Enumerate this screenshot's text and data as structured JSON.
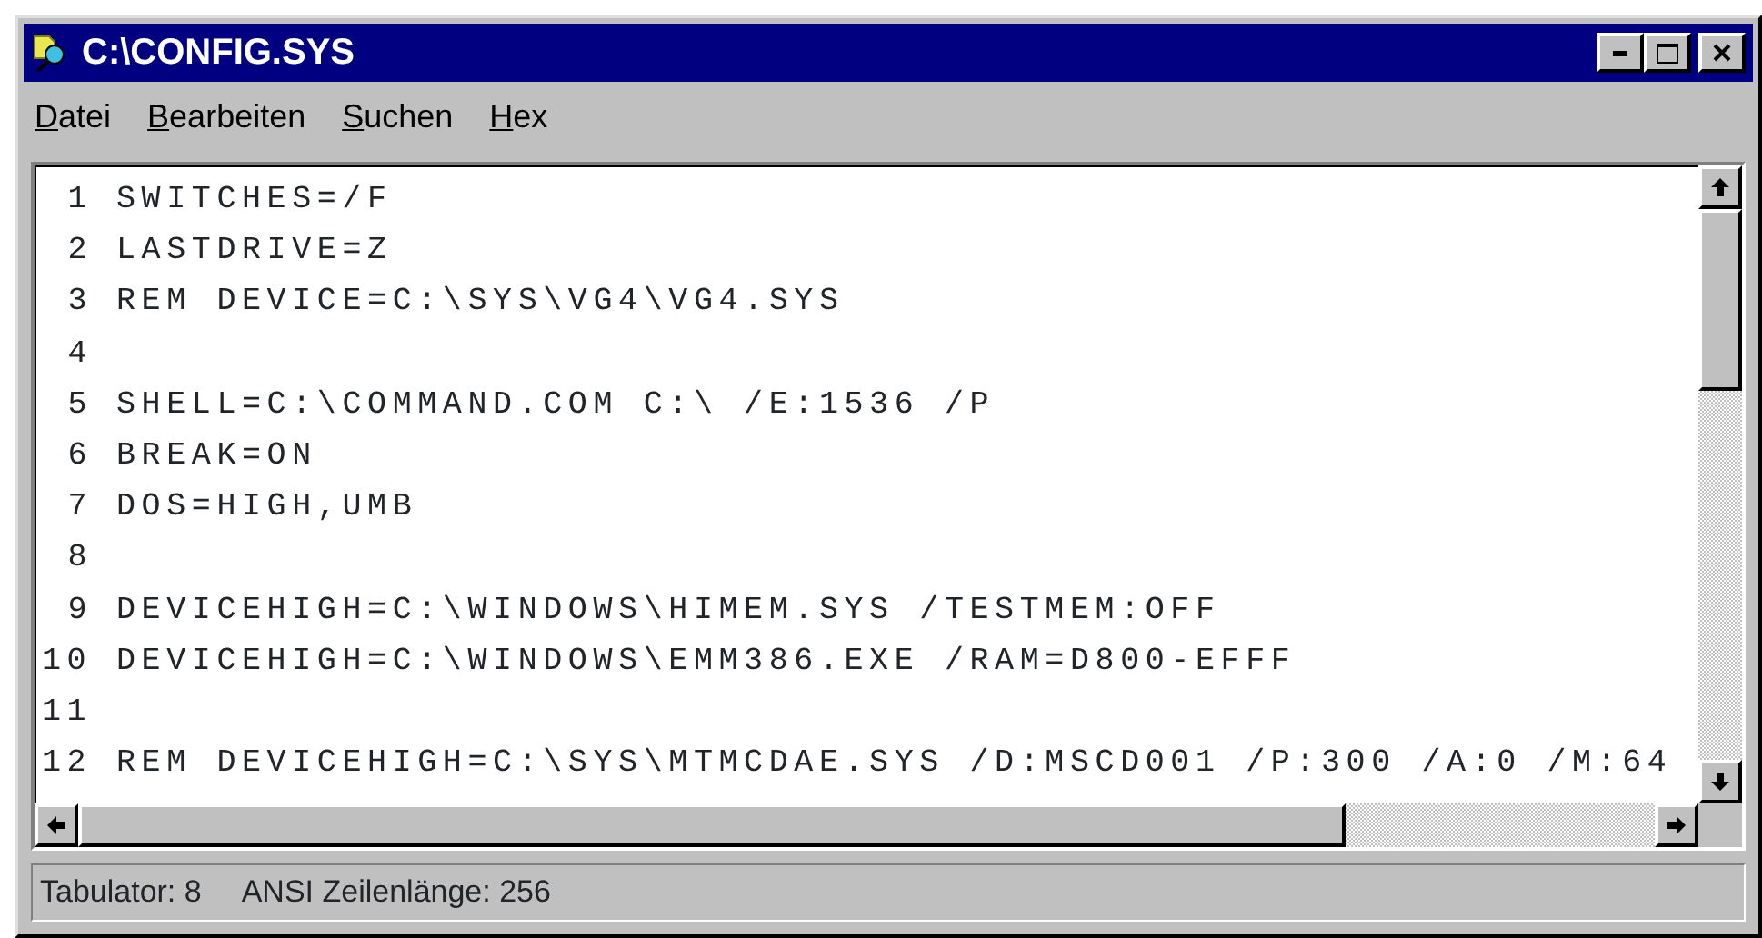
{
  "window": {
    "title": "C:\\CONFIG.SYS"
  },
  "menu": [
    {
      "label": "Datei"
    },
    {
      "label": "Bearbeiten"
    },
    {
      "label": "Suchen"
    },
    {
      "label": "Hex"
    }
  ],
  "lines": [
    {
      "number": "1",
      "text": "SWITCHES=/F"
    },
    {
      "number": "2",
      "text": "LASTDRIVE=Z"
    },
    {
      "number": "3",
      "text": "REM DEVICE=C:\\SYS\\VG4\\VG4.SYS"
    },
    {
      "number": "4"
    },
    {
      "number": "5",
      "text": "SHELL=C:\\COMMAND.COM C:\\ /E:1536 /P"
    },
    {
      "number": "6",
      "text": "BREAK=ON"
    },
    {
      "number": "7",
      "text": "DOS=HIGH,UMB"
    },
    {
      "number": "8"
    },
    {
      "number": "9",
      "text": "DEVICEHIGH=C:\\WINDOWS\\HIMEM.SYS /TESTMEM:OFF"
    },
    {
      "number": "10",
      "text": "DEVICEHIGH=C:\\WINDOWS\\EMM386.EXE /RAM=D800-EFFF"
    },
    {
      "number": "11"
    },
    {
      "number": "12",
      "text": "REM DEVICEHIGH=C:\\SYS\\MTMCDAE.SYS /D:MSCD001 /P:300 /A:0 /M:64"
    }
  ],
  "status_bar": [
    "Tabulator: 8",
    "ANSI Zeilenlänge: 256"
  ]
}
